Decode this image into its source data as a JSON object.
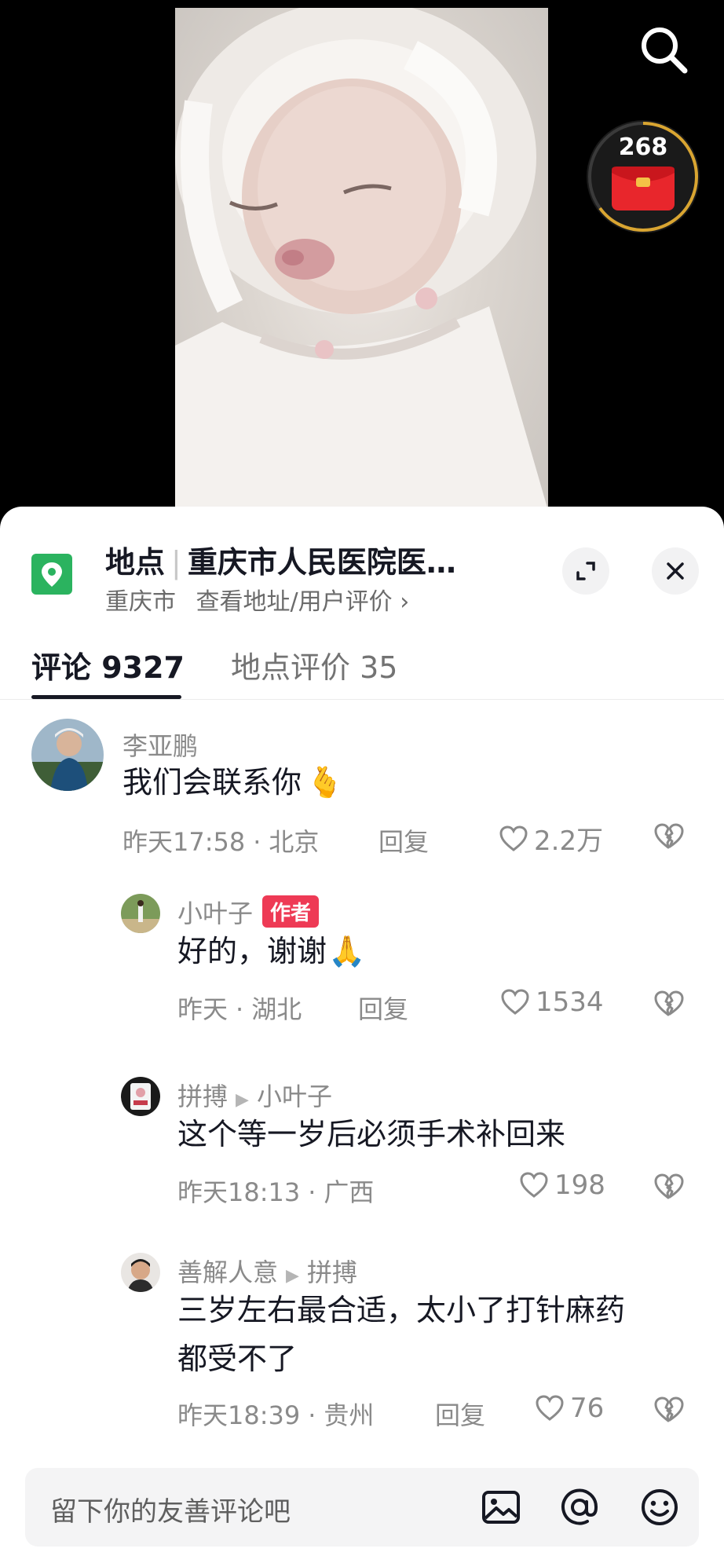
{
  "video": {
    "redpacket_count": "268",
    "colors": {
      "gold_ring": "#d9a531",
      "red": "#e8262c"
    }
  },
  "location": {
    "label": "地点",
    "name": "重庆市人民医院医…",
    "city": "重庆市",
    "link": "查看地址/用户评价",
    "pin_color": "#2bb35f"
  },
  "tabs": {
    "comments": "评论 9327",
    "reviews": "地点评价 35"
  },
  "comments": [
    {
      "author": "李亚鹏",
      "text": "我们会联系你",
      "emoji": "🫰",
      "time": "昨天17:58",
      "region": "北京",
      "reply": "回复",
      "likes": "2.2万"
    },
    {
      "author": "小叶子",
      "badge": "作者",
      "text": "好的，谢谢",
      "emoji": "🙏",
      "time": "昨天",
      "region": "湖北",
      "reply": "回复",
      "likes": "1534"
    },
    {
      "author": "拼搏",
      "reply_to": "小叶子",
      "text": "这个等一岁后必须手术补回来",
      "time": "昨天18:13",
      "region": "广西",
      "likes": "198"
    },
    {
      "author": "善解人意",
      "reply_to": "拼搏",
      "text_line1": "三岁左右最合适，太小了打针麻药",
      "text_line2": "都受不了",
      "time": "昨天18:39",
      "region": "贵州",
      "reply": "回复",
      "likes": "76"
    }
  ],
  "input": {
    "placeholder": "留下你的友善评论吧"
  }
}
